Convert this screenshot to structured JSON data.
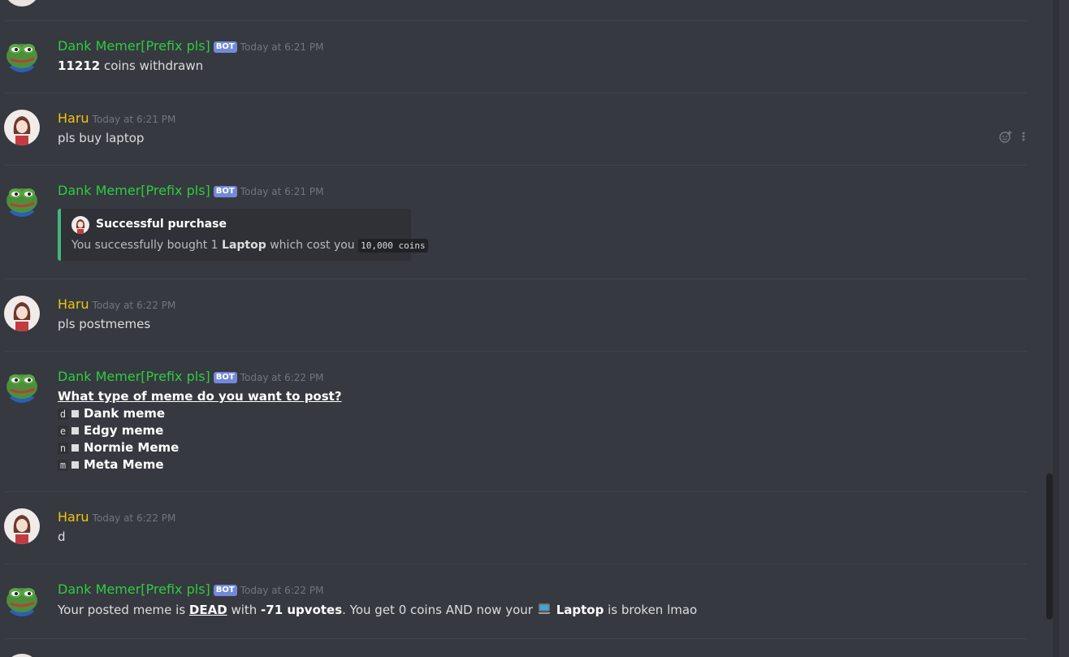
{
  "bot_name": "Dank Memer[Prefix pls]",
  "bot_tag": "BOT",
  "user_name": "Haru",
  "messages": [
    {
      "timestamp": "Today at 6:21 PM",
      "amount": "11212",
      "text": " coins withdrawn"
    },
    {
      "timestamp": "Today at 6:21 PM",
      "text": "pls buy laptop"
    },
    {
      "timestamp": "Today at 6:21 PM",
      "embed": {
        "title": "Successful purchase",
        "desc_pre": "You successfully bought 1 ",
        "item": "Laptop",
        "desc_mid": " which cost you ",
        "cost": "10,000 coins"
      }
    },
    {
      "timestamp": "Today at 6:22 PM",
      "text": "pls postmemes"
    },
    {
      "timestamp": "Today at 6:22 PM",
      "question": "What type of meme do you want to post?",
      "options": [
        {
          "key": "d",
          "label": "Dank meme"
        },
        {
          "key": "e",
          "label": "Edgy meme"
        },
        {
          "key": "n",
          "label": "Normie Meme"
        },
        {
          "key": "m",
          "label": "Meta Meme"
        }
      ]
    },
    {
      "timestamp": "Today at 6:22 PM",
      "text": "d"
    },
    {
      "timestamp": "Today at 6:22 PM",
      "p1": "Your posted meme is ",
      "dead": "DEAD",
      "p2": " with ",
      "upvotes": "-71 upvotes",
      "p3": ". You get 0 coins AND now your ",
      "item": "Laptop",
      "p4": " is broken lmao"
    }
  ],
  "colors": {
    "bot": "#2ecc40",
    "user": "#f1c40f",
    "accent": "#7289da",
    "embed_border": "#43b581"
  },
  "icons": [
    "frog-avatar",
    "girl-avatar",
    "add-reaction-icon",
    "more-options-icon",
    "laptop-icon"
  ]
}
